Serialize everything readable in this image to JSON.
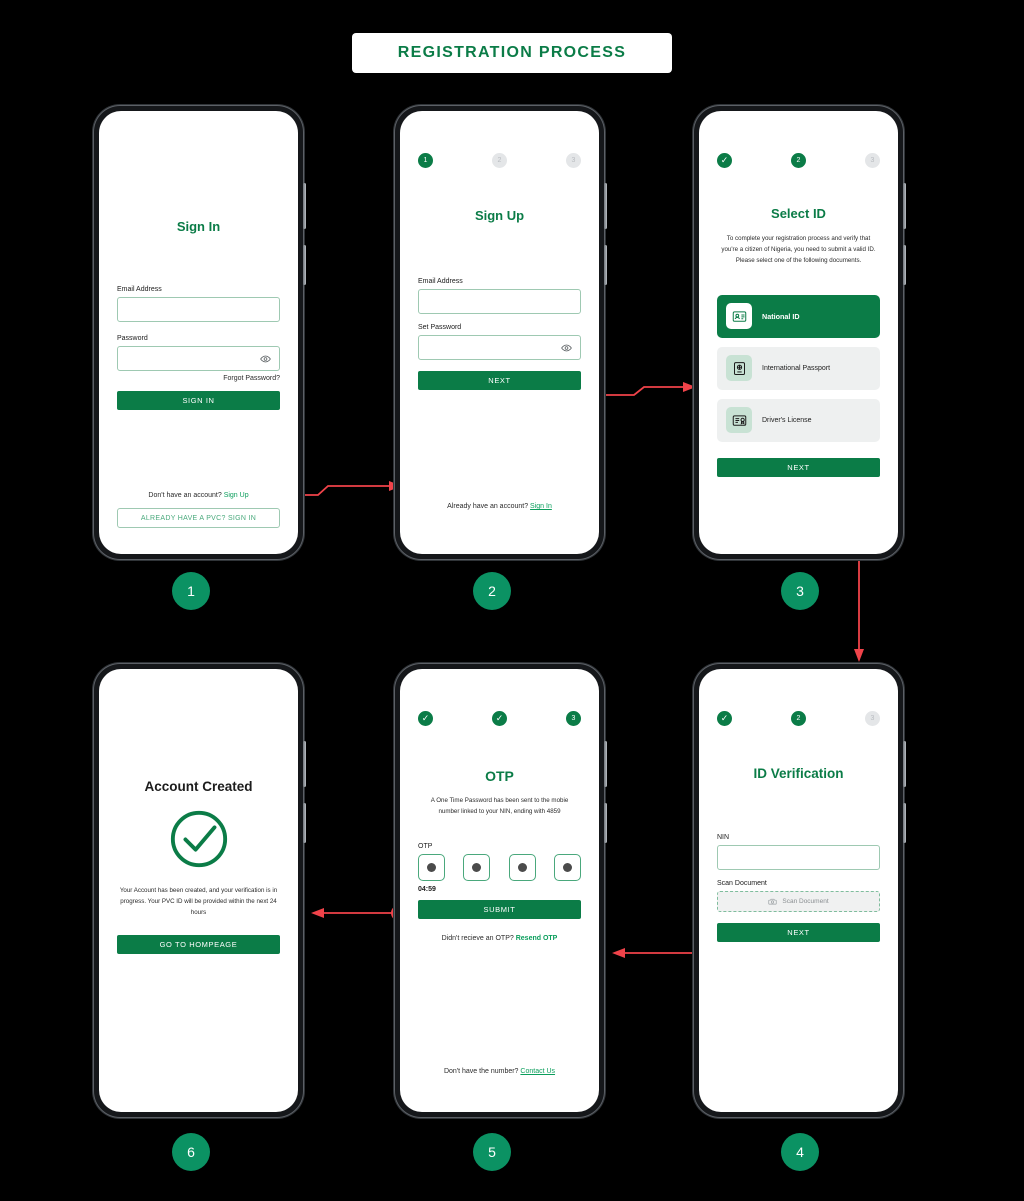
{
  "header": {
    "title": "REGISTRATION  PROCESS"
  },
  "theme": {
    "brand_green": "#0b7c47",
    "link_green": "#0b9e5c",
    "badge_green": "#0b9263",
    "connector_red": "#f0434a",
    "background": "#000000"
  },
  "screens": [
    {
      "badge": "1",
      "name": "sign-in",
      "title": "Sign In",
      "fields": [
        {
          "label": "Email Address",
          "value": "",
          "placeholder": ""
        },
        {
          "label": "Password",
          "value": "",
          "placeholder": ""
        }
      ],
      "forgot_password": "Forgot Password?",
      "primary_button": "SIGN IN",
      "footer_text": "Don't have an account?",
      "footer_link": "Sign Up",
      "outline_button": "ALREADY HAVE A PVC? SIGN IN"
    },
    {
      "badge": "2",
      "name": "sign-up",
      "title": "Sign Up",
      "steps": [
        {
          "label": "1",
          "state": "active"
        },
        {
          "label": "2",
          "state": "inactive"
        },
        {
          "label": "3",
          "state": "inactive"
        }
      ],
      "fields": [
        {
          "label": "Email Address",
          "value": "",
          "placeholder": ""
        },
        {
          "label": "Set Password",
          "value": "",
          "placeholder": ""
        }
      ],
      "primary_button": "NEXT",
      "footer_text": "Already have an account?",
      "footer_link": "Sign In"
    },
    {
      "badge": "3",
      "name": "select-id",
      "title": "Select ID",
      "steps": [
        {
          "label": "✓",
          "state": "done"
        },
        {
          "label": "2",
          "state": "active"
        },
        {
          "label": "3",
          "state": "inactive"
        }
      ],
      "description": "To complete your registration process and verify that you're a citizen of Nigeria, you need to submit a valid ID.  Please select one of the following documents.",
      "options": [
        {
          "label": "National ID",
          "icon": "id-card-icon",
          "selected": true
        },
        {
          "label": "International Passport",
          "icon": "passport-icon",
          "selected": false
        },
        {
          "label": "Driver's License",
          "icon": "drivers-license-icon",
          "selected": false
        }
      ],
      "primary_button": "NEXT"
    },
    {
      "badge": "4",
      "name": "id-verification",
      "title": "ID Verification",
      "steps": [
        {
          "label": "✓",
          "state": "done"
        },
        {
          "label": "2",
          "state": "active"
        },
        {
          "label": "3",
          "state": "inactive"
        }
      ],
      "fields": [
        {
          "label": "NIN",
          "value": "",
          "placeholder": ""
        }
      ],
      "scan_label": "Scan Document",
      "scan_placeholder": "Scan Document",
      "scan_icon": "camera-icon",
      "primary_button": "NEXT"
    },
    {
      "badge": "5",
      "name": "otp",
      "title": "OTP",
      "steps": [
        {
          "label": "✓",
          "state": "done"
        },
        {
          "label": "✓",
          "state": "done"
        },
        {
          "label": "3",
          "state": "active"
        }
      ],
      "description": "A One Time Password has been sent to the mobie number linked to your NIN, ending with 4859",
      "otp_label": "OTP",
      "otp_digits": [
        "●",
        "●",
        "●",
        "●"
      ],
      "timer": "04:59",
      "primary_button": "SUBMIT",
      "resend_text": "Didn't recieve an OTP?",
      "resend_link": "Resend OTP",
      "footer_text": "Don't have the number?",
      "footer_link": "Contact Us"
    },
    {
      "badge": "6",
      "name": "account-created",
      "title": "Account Created",
      "success_icon": "check-circle-icon",
      "description": "Your Account has been created, and your verification is in progress. Your PVC ID will be provided within the next 24 hours",
      "primary_button": "GO TO HOMPEAGE"
    }
  ]
}
